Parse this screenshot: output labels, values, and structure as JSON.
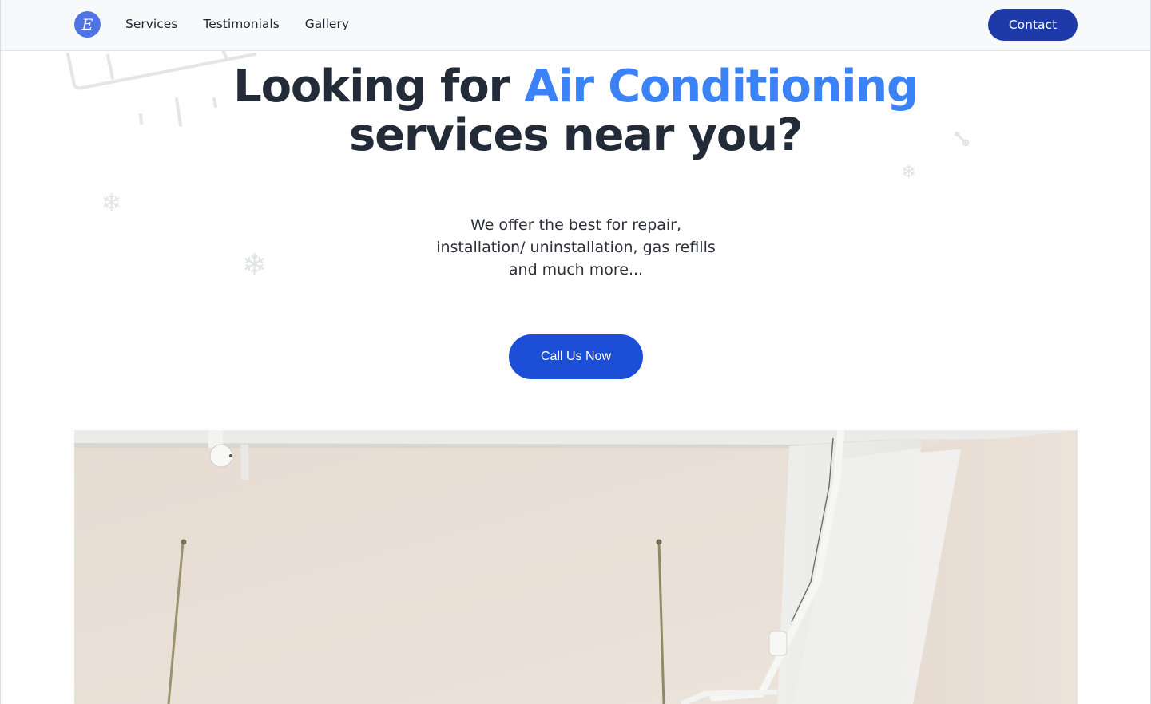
{
  "nav": {
    "logo_letter": "E",
    "links": [
      "Services",
      "Testimonials",
      "Gallery"
    ],
    "contact_label": "Contact"
  },
  "hero": {
    "title_part1": "Looking for ",
    "title_accent": "Air Conditioning",
    "title_part2": "services near you?",
    "subtitle_line1": "We offer the best for repair,",
    "subtitle_line2": "installation/ uninstallation, gas refills",
    "subtitle_line3": "and much more...",
    "cta_label": "Call Us Now"
  },
  "decor_icons": {
    "snowflake": "❄"
  },
  "colors": {
    "accent": "#3b82f6",
    "primary_button": "#1d4ed8",
    "contact_button": "#1d3aa8",
    "logo": "#4f74e6",
    "title": "#232a38"
  }
}
